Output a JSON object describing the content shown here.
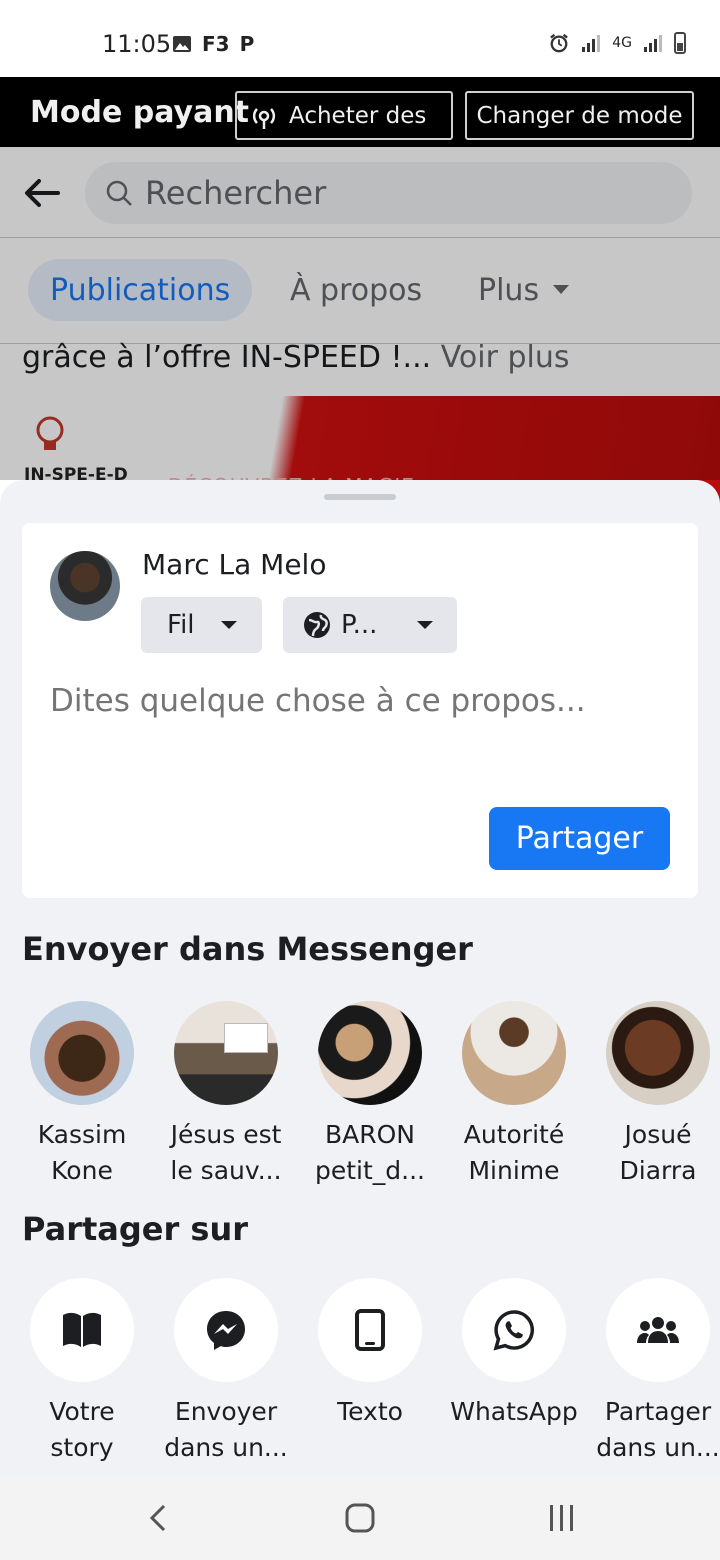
{
  "status_bar": {
    "time": "11:05",
    "left_icons": [
      "image-icon",
      "F3",
      "P"
    ],
    "network": "4G"
  },
  "mode_bar": {
    "title": "Mode payant",
    "buy_label": "Acheter des",
    "change_label": "Changer de mode"
  },
  "background": {
    "search_placeholder": "Rechercher",
    "tabs": [
      {
        "label": "Publications"
      },
      {
        "label": "À propos"
      },
      {
        "label": "Plus"
      }
    ],
    "post_text": "grâce à l’offre IN-SPEED !...",
    "see_more": "Voir plus",
    "brand": "IN-SPE-E-D",
    "image_caption": "DÉCOUVREZ LA MAGIE"
  },
  "composer": {
    "user_name": "Marc La Melo",
    "audience_label": "Fil",
    "privacy_label": "P...",
    "placeholder": "Dites quelque chose à ce propos...",
    "share_label": "Partager"
  },
  "messenger": {
    "title": "Envoyer dans Messenger",
    "contacts": [
      {
        "name": "Kassim\nKone"
      },
      {
        "name": "Jésus est\nle sauv..."
      },
      {
        "name": "BARON\npetit_d..."
      },
      {
        "name": "Autorité\nMinime"
      },
      {
        "name": "Josué\nDiarra"
      }
    ]
  },
  "share_on": {
    "title": "Partager sur",
    "options": [
      {
        "label": "Votre\nstory",
        "icon": "book-icon"
      },
      {
        "label": "Envoyer\ndans un...",
        "icon": "messenger-icon"
      },
      {
        "label": "Texto",
        "icon": "phone-icon"
      },
      {
        "label": "WhatsApp",
        "icon": "whatsapp-icon"
      },
      {
        "label": "Partager\ndans un...",
        "icon": "group-icon"
      }
    ]
  },
  "colors": {
    "accent": "#1877f2",
    "sheet_bg": "#f0f2f5",
    "active_tab_bg": "#e7f0fd"
  }
}
